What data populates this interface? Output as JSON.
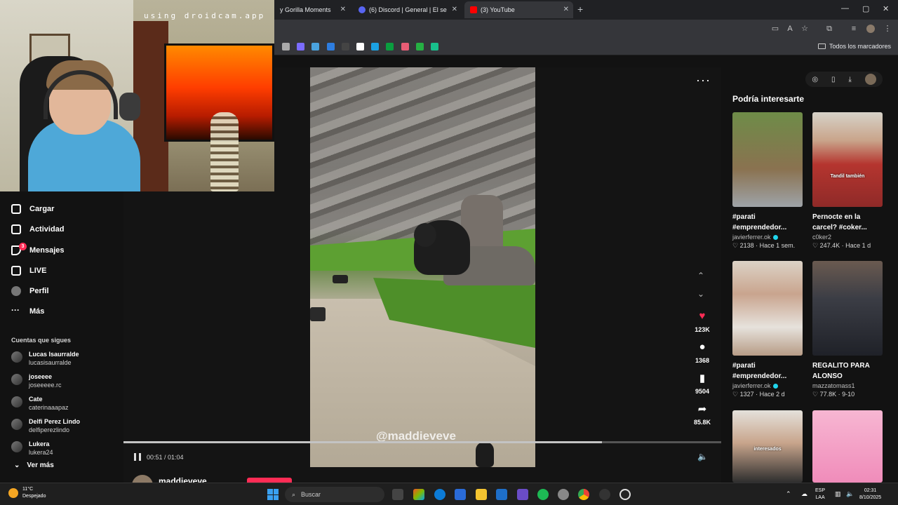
{
  "browser": {
    "tabs": [
      {
        "label": "y Gorilla Moments",
        "color": "#ffffff"
      },
      {
        "label": "(6) Discord | General | El se",
        "color": "#5865f2"
      },
      {
        "label": "(3) YouTube",
        "color": "#ff0000"
      }
    ],
    "new_tab": "+",
    "bookmarks_all": "Todos los marcadores",
    "bookmark_colors": [
      "#aaaaaa",
      "#7b6cff",
      "#4aa3df",
      "#2d7de0",
      "#444444",
      "#ffffff",
      "#1ba1e2",
      "#0a9e3f",
      "#e85d75",
      "#26b043",
      "#18c08c"
    ]
  },
  "camera": {
    "watermark": "using droidcam.app"
  },
  "sidebar": {
    "nav": [
      {
        "label": "Cargar",
        "icon": "upload-icon"
      },
      {
        "label": "Actividad",
        "icon": "activity-icon"
      },
      {
        "label": "Mensajes",
        "icon": "messages-icon",
        "badge": "3"
      },
      {
        "label": "LIVE",
        "icon": "live-icon"
      },
      {
        "label": "Perfil",
        "icon": "profile-icon"
      },
      {
        "label": "Más",
        "icon": "more-icon"
      }
    ],
    "following_title": "Cuentas que sigues",
    "accounts": [
      {
        "name": "Lucas Isaurralde",
        "user": "lucasisaurralde"
      },
      {
        "name": "joseeee",
        "user": "joseeeee.rc"
      },
      {
        "name": "Cate",
        "user": "caterinaaapaz"
      },
      {
        "name": "Delfi Perez Lindo",
        "user": "delfiperezlindo"
      },
      {
        "name": "Lukera",
        "user": "lukera24"
      }
    ],
    "see_more": "Ver más"
  },
  "video": {
    "watermark": "@maddieveve",
    "time": "00:51 / 01:04",
    "progress": 0.8,
    "author": "maddieveve",
    "actions": {
      "likes": "123K",
      "comments": "1368",
      "saves": "9504",
      "shares": "85.8K"
    }
  },
  "recommendations": {
    "title": "Podría interesarte",
    "cards": [
      {
        "title": "#parati\n#emprendedor...",
        "user": "javierferrer.ok",
        "verified": true,
        "likes": "2138",
        "age": "Hace 1 sem.",
        "overlay": "",
        "thumb_color": "#5a7a3a"
      },
      {
        "title": "Pernocte en la\ncarcel? #coker...",
        "user": "c0ker2",
        "verified": false,
        "likes": "247.4K",
        "age": "Hace 1 d",
        "overlay": "Tandil también",
        "thumb_color": "#b5352f"
      },
      {
        "title": "#parati\n#emprendedor...",
        "user": "javierferrer.ok",
        "verified": true,
        "likes": "1327",
        "age": "Hace 2 d",
        "overlay": "",
        "thumb_color": "#c7b7a6"
      },
      {
        "title": "REGALITO PARA\nALONSO",
        "user": "mazzatomass1",
        "verified": false,
        "likes": "77.8K",
        "age": "9-10",
        "overlay": "",
        "thumb_color": "#3b3d45"
      },
      {
        "title": "",
        "user": "",
        "verified": false,
        "likes": "",
        "age": "",
        "overlay": "interesados",
        "thumb_color": "#d9d6d0"
      },
      {
        "title": "",
        "user": "",
        "verified": false,
        "likes": "",
        "age": "",
        "overlay": "",
        "thumb_color": "#f4a6c8"
      }
    ]
  },
  "taskbar": {
    "weather_temp": "11°C",
    "weather_desc": "Despejado",
    "search_placeholder": "Buscar",
    "lang": "ESP",
    "lang2": "LAA",
    "time": "02:31",
    "date": "8/10/2025"
  }
}
